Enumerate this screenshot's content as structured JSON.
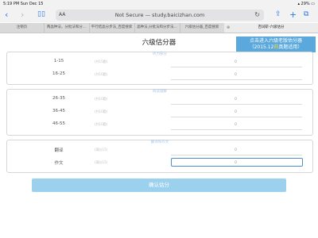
{
  "status_bar": {
    "time": "5:19 PM",
    "date": "Sun Dec 15",
    "battery": "29%"
  },
  "browser": {
    "aa_label": "AA",
    "url": "Not Secure — study.baicizhan.com",
    "tabs": [
      {
        "label": "注销页"
      },
      {
        "label": "两晶种法，分批法和分..."
      },
      {
        "label": "平行结晶分步法_百度搜索"
      },
      {
        "label": "晶种法,分批法和分步法..."
      },
      {
        "label": "六级估分器_百度搜索"
      },
      {
        "label": "百词斩-六级估分"
      }
    ]
  },
  "page": {
    "title": "六级估分器",
    "promo": {
      "line1": "点击进入六级老版估分器",
      "line2_pre": "（2015.12",
      "line2_highlight": "前",
      "line2_post": "真题适用）"
    },
    "sections": [
      {
        "label": "听力部分",
        "rows": [
          {
            "name": "1-15",
            "hint": "(共15题)",
            "value": "0"
          },
          {
            "name": "16-25",
            "hint": "(共10题)",
            "value": "0"
          }
        ]
      },
      {
        "label": "阅读理解",
        "rows": [
          {
            "name": "26-35",
            "hint": "(共10题)",
            "value": "0"
          },
          {
            "name": "36-45",
            "hint": "(共10题)",
            "value": "0"
          },
          {
            "name": "46-55",
            "hint": "(共10题)",
            "value": "0"
          }
        ]
      },
      {
        "label": "翻译和作文",
        "rows": [
          {
            "name": "翻译",
            "hint": "(满分15)",
            "value": "0"
          },
          {
            "name": "作文",
            "hint": "(满分15)",
            "value": "0"
          }
        ]
      }
    ],
    "submit_label": "确认估分"
  }
}
